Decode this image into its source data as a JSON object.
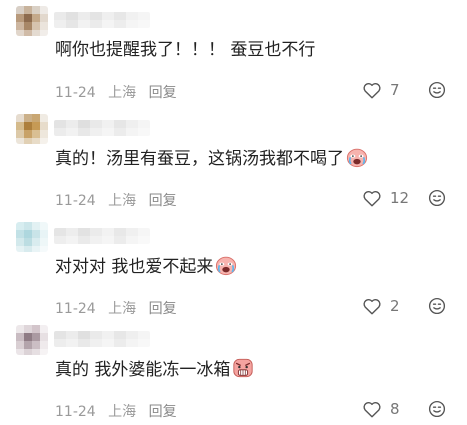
{
  "comments": [
    {
      "text": "啊你也提醒我了！！！ 蚕豆也不行",
      "has_emoji": false,
      "date": "11-24",
      "location": "上海",
      "reply_label": "回复",
      "likes": "7"
    },
    {
      "text": "真的！汤里有蚕豆，这锅汤我都不喝了",
      "has_emoji": true,
      "emoji_icon": "crying-face-sticker",
      "date": "11-24",
      "location": "上海",
      "reply_label": "回复",
      "likes": "12"
    },
    {
      "text": "对对对 我也爱不起来",
      "has_emoji": true,
      "emoji_icon": "crying-face-sticker",
      "date": "11-24",
      "location": "上海",
      "reply_label": "回复",
      "likes": "2"
    },
    {
      "text": "真的 我外婆能冻一冰箱",
      "has_emoji": true,
      "emoji_icon": "screaming-face-sticker",
      "date": "11-24",
      "location": "上海",
      "reply_label": "回复",
      "likes": "8"
    }
  ],
  "colors": {
    "text": "#222222",
    "meta": "#9a9a9a",
    "icon": "#555555",
    "sticker": "#f6a6a6"
  }
}
